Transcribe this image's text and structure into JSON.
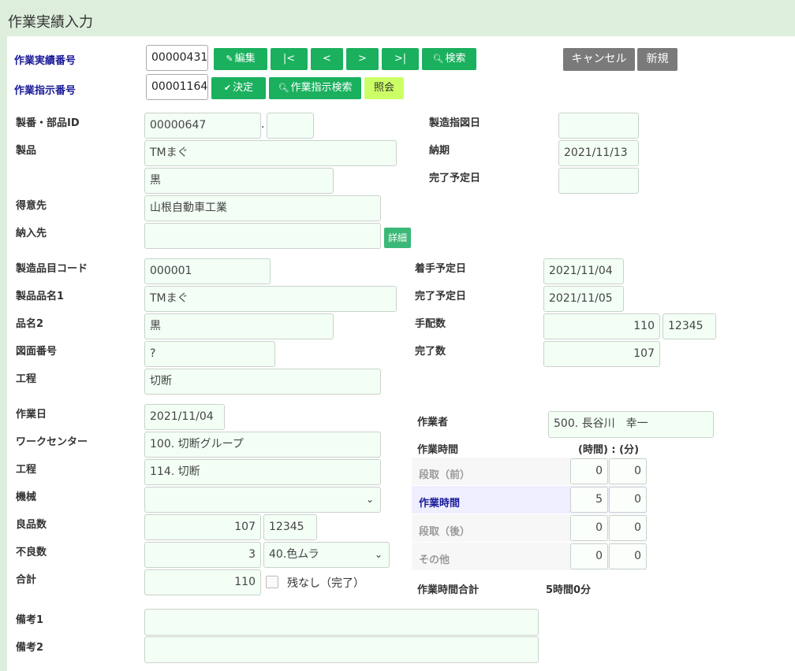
{
  "header": {
    "title": "作業実績入力"
  },
  "top": {
    "record_no_label": "作業実績番号",
    "record_no": "00000431",
    "order_no_label": "作業指示番号",
    "order_no": "00001164",
    "btn_edit": "編集",
    "btn_first": "|<",
    "btn_prev": "<",
    "btn_next": ">",
    "btn_last": ">|",
    "btn_search": "検索",
    "btn_decide": "決定",
    "btn_order_search": "作業指示検索",
    "btn_inquiry": "照会",
    "btn_cancel": "キャンセル",
    "btn_new": "新規"
  },
  "section1": {
    "part_id_label": "製番・部品ID",
    "part_id": "00000647",
    "part_id_sep": ".",
    "part_id_sub": "",
    "product_label": "製品",
    "product": "TMまぐ",
    "product_color": "黒",
    "customer_label": "得意先",
    "customer": "山根自動車工業",
    "delivery_label": "納入先",
    "delivery": "",
    "detail_btn": "詳細",
    "mfg_order_date_label": "製造指図日",
    "mfg_order_date": "",
    "due_label": "納期",
    "due": "2021/11/13",
    "planned_end_label": "完了予定日",
    "planned_end": ""
  },
  "section2": {
    "item_code_label": "製造品目コード",
    "item_code": "000001",
    "item_name1_label": "製品品名1",
    "item_name1": "TMまぐ",
    "item_name2_label": "品名2",
    "item_name2": "黒",
    "drawing_label": "図面番号",
    "drawing": "?",
    "process_label": "工程",
    "process": "切断",
    "start_plan_label": "着手予定日",
    "start_plan": "2021/11/04",
    "end_plan_label": "完了予定日",
    "end_plan": "2021/11/05",
    "arranged_label": "手配数",
    "arranged": "110",
    "arranged_sub": "12345",
    "done_label": "完了数",
    "done": "107"
  },
  "section3": {
    "work_date_label": "作業日",
    "work_date": "2021/11/04",
    "work_center_label": "ワークセンター",
    "work_center": "100. 切断グループ",
    "process_label": "工程",
    "process": "114. 切断",
    "machine_label": "機械",
    "machine": "",
    "good_label": "良品数",
    "good": "107",
    "good_sub": "12345",
    "defect_label": "不良数",
    "defect": "3",
    "defect_reason": "40.色ムラ",
    "total_label": "合計",
    "total": "110",
    "no_remaining_label": "残なし（完了）",
    "worker_label": "作業者",
    "worker": "500. 長谷川　幸一",
    "work_time_label": "作業時間",
    "units_label": "(時間) : (分)",
    "time_rows": [
      {
        "label": "段取（前）",
        "hours": "0",
        "minutes": "0"
      },
      {
        "label": "作業時間",
        "hours": "5",
        "minutes": "0"
      },
      {
        "label": "段取（後）",
        "hours": "0",
        "minutes": "0"
      },
      {
        "label": "その他",
        "hours": "0",
        "minutes": "0"
      }
    ],
    "total_time_label": "作業時間合計",
    "total_time": "5時間0分"
  },
  "remarks": {
    "remark1_label": "備考1",
    "remark1": "",
    "remark2_label": "備考2",
    "remark2": ""
  },
  "icons": {
    "edit": "edit-icon",
    "search": "search-icon",
    "check": "check-icon",
    "chevron": "chevron-down-icon"
  }
}
